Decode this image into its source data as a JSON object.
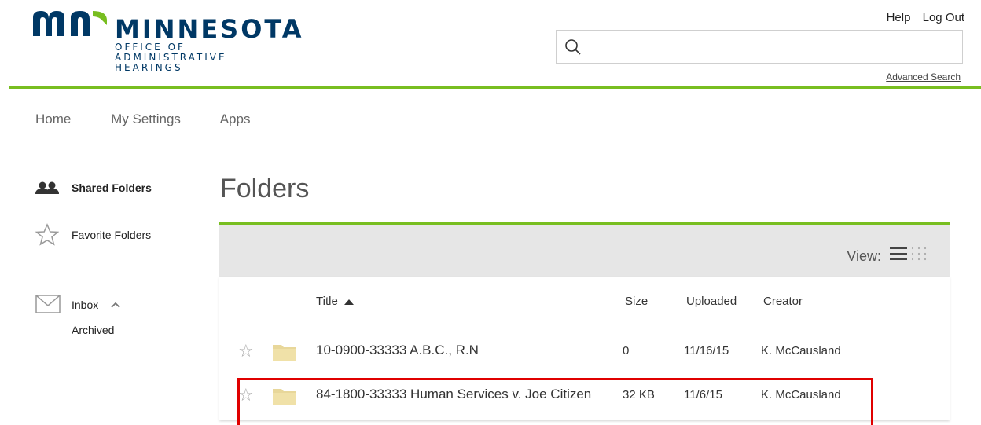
{
  "header": {
    "logo_main": "MINNESOTA",
    "logo_sub": [
      "OFFICE OF",
      "ADMINISTRATIVE",
      "HEARINGS"
    ],
    "help_label": "Help",
    "logout_label": "Log Out",
    "search_placeholder": "",
    "advanced_search_label": "Advanced Search"
  },
  "nav": {
    "items": [
      "Home",
      "My Settings",
      "Apps"
    ]
  },
  "sidebar": {
    "shared_folders": "Shared Folders",
    "favorite_folders": "Favorite Folders",
    "inbox": "Inbox",
    "archived": "Archived"
  },
  "main": {
    "title": "Folders",
    "view_label": "View:",
    "columns": {
      "title": "Title",
      "size": "Size",
      "uploaded": "Uploaded",
      "creator": "Creator"
    },
    "rows": [
      {
        "title": "10-0900-33333 A.B.C., R.N",
        "size": "0",
        "uploaded": "11/16/15",
        "creator": "K. McCausland"
      },
      {
        "title": "84-1800-33333 Human Services v. Joe Citizen",
        "size": "32 KB",
        "uploaded": "11/6/15",
        "creator": "K. McCausland"
      }
    ]
  },
  "colors": {
    "accent_green": "#78be20",
    "brand_blue": "#003865",
    "highlight_red": "#e00000",
    "folder": "#e8d79a"
  },
  "icons": [
    "search-icon",
    "people-icon",
    "star-icon",
    "mail-icon",
    "chevron-up-icon",
    "list-view-icon",
    "grid-view-icon",
    "folder-icon"
  ]
}
